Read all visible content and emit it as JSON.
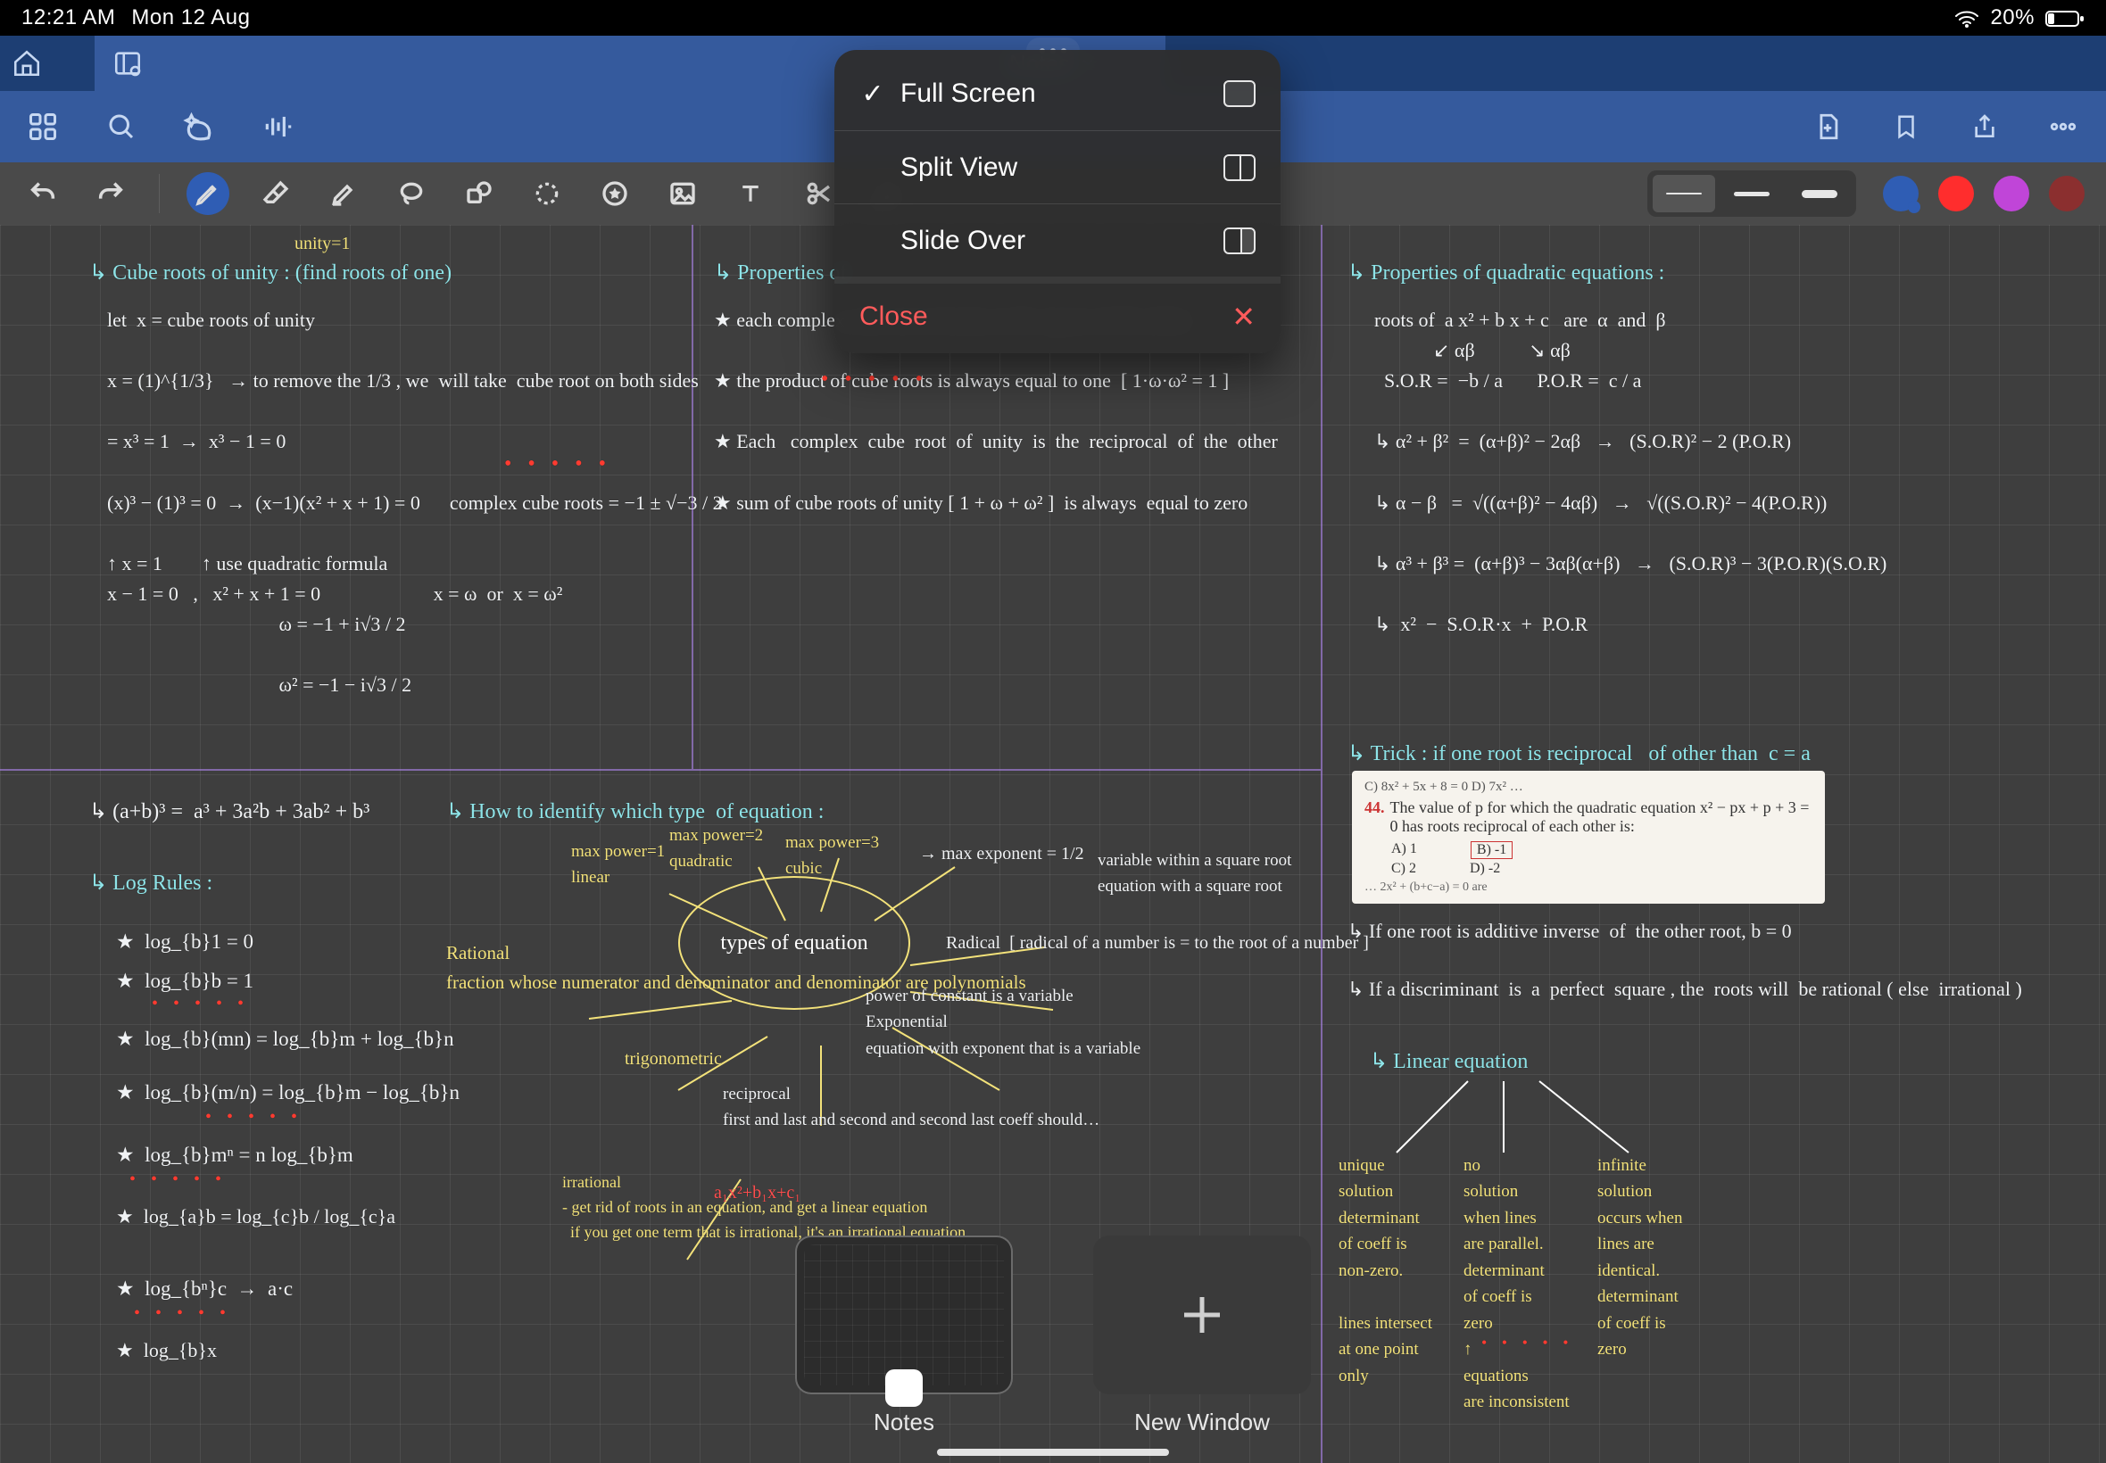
{
  "status": {
    "time": "12:21 AM",
    "date": "Mon 12 Aug",
    "battery_pct": "20%"
  },
  "app": {
    "tab_title": "Notes"
  },
  "toolbar_icons": {
    "grid": "grid-icon",
    "search": "search-icon",
    "ai": "sparkle-icon",
    "audio": "waveform-icon",
    "add_page": "new-page-icon",
    "bookmark": "bookmark-icon",
    "share": "share-icon",
    "more": "more-icon"
  },
  "tool_strip": {
    "tools": [
      "undo",
      "redo",
      "pen",
      "eraser",
      "highlighter",
      "lasso",
      "shape",
      "circular-select",
      "stamp",
      "image",
      "text",
      "scissors",
      "ruler"
    ],
    "weights": [
      "thin",
      "medium",
      "thick"
    ],
    "active_weight": "thin",
    "colors": [
      "#2f5db4",
      "#ff2d2d",
      "#c045d8",
      "#8b2f2f"
    ],
    "selected_color_index": 0
  },
  "popover": {
    "full_screen": "Full Screen",
    "split_view": "Split View",
    "slide_over": "Slide Over",
    "close": "Close",
    "selected": "Full Screen"
  },
  "switcher": {
    "notes_label": "Notes",
    "new_window_label": "New Window"
  },
  "notes": {
    "col1_heading": "↳ Cube roots of unity : (find roots of one)",
    "col1_body": "let  x = cube roots of unity\n\nx = (1)^{1/3}   → to remove the 1/3 , we  will take  cube root on both sides\n\n= x³ = 1  →  x³ − 1 = 0\n\n(x)³ − (1)³ = 0  →  (x−1)(x² + x + 1) = 0      complex cube roots = −1 ± √−3 / 2\n\n↑ x = 1        ↑ use quadratic formula\nx − 1 = 0   ,   x² + x + 1 = 0                       x = ω  or  x = ω²\n                                   ω = −1 + i√3 / 2\n\n                                   ω² = −1 − i√3 / 2",
    "col1b_heading": "↳ (a+b)³ =  a³ + 3a²b + 3ab² + b³",
    "log_heading": "↳ Log Rules :",
    "log_lines": [
      "★  log_{b}1 = 0",
      "★  log_{b}b = 1",
      "★  log_{b}(mn) = log_{b}m + log_{b}n",
      "★  log_{b}(m/n) = log_{b}m − log_{b}n",
      "★  log_{b}mⁿ = n log_{b}m",
      "★  log_{a}b = log_{c}b / log_{c}a",
      "★  log_{bⁿ}c  →  a·c"
    ],
    "log_extra": "★  log_{b}x",
    "col2_heading": "↳ Properties of",
    "col2_body": "★ each complex cube root of unity is the square of the other\n\n★ the product of cube roots is always equal to one  [ 1·ω·ω² = 1 ]\n\n★ Each   complex  cube  root  of  unity  is  the  reciprocal  of  the  other\n\n★ sum of cube roots of unity [ 1 + ω + ω² ]  is always  equal to zero",
    "mind_heading": "↳ How to identify which type  of equation :",
    "mind_center": "types of\nequation",
    "mind_branches": {
      "linear": "max power=1\nlinear",
      "quadratic": "max power=2\nquadratic",
      "cubic": "max power=3\ncubic",
      "half": "→ max exponent = 1/2",
      "sq": "variable within a square root\nequation with a square root",
      "radical": "Radical  [ radical of a number is = to the root of a number ]",
      "exp": "power of constant is a variable\nExponential\nequation with exponent that is a variable",
      "trig": "trigonometric",
      "rec": "reciprocal\nfirst and last and second and second last coeff should…",
      "rational": "Rational\nfraction whose numerator and denominator and denominator are polynomials",
      "irr": "irrational\n- get rid of roots in an equation, and get a linear equation\n  if you get one term that is irrational, it's an irrational equation"
    },
    "col3_heading": "↳ Properties of quadratic equations :",
    "col3_body": "roots of  a x² + b x + c   are  α  and  β\n            ↙ αβ           ↘ αβ\n  S.O.R =  −b / a       P.O.R =  c / a\n\n↳ α² + β²  =  (α+β)² − 2αβ   →   (S.O.R)² − 2 (P.O.R)\n\n↳ α − β   =  √((α+β)² − 4αβ)   →   √((S.O.R)² − 4(P.O.R))\n\n↳ α³ + β³ =  (α+β)³ − 3αβ(α+β)   →   (S.O.R)³ − 3(P.O.R)(S.O.R)\n\n↳  x²  −  S.O.R·x  +  P.O.R",
    "trick_heading": "↳ Trick : if one root is reciprocal   of other than  c = a",
    "qclip": {
      "prefix": "44.",
      "q": "The value of p for which the quadratic equation  x² − px + p + 3 = 0  has roots reciprocal of each other is:",
      "a": "A)  1",
      "b": "B)  -1",
      "c": "C)  2",
      "d": "D)  -2",
      "topline": "C) 8x² + 5x + 8 = 0                 D) 7x² …",
      "bottom": "… 2x² + (b+c−a) = 0  are"
    },
    "addinv": "↳ If one root is additive inverse  of  the other root, b = 0",
    "disc": "↳ If a discriminant  is  a  perfect  square , the  roots will  be rational ( else  irrational )",
    "linear_heading": "↳ Linear equation",
    "linear_cols": {
      "uniq": "unique\nsolution\ndeterminant\nof coeff is\nnon-zero.\n\nlines intersect\nat one point\nonly",
      "no": "no\nsolution\nwhen lines\nare parallel.\ndeterminant\nof coeff is\nzero\n↑\nequations\nare inconsistent",
      "inf": "infinite\nsolution\noccurs when\nlines are\nidentical.\ndeterminant\nof coeff is\nzero"
    },
    "unity_label": "unity=1",
    "red_dots": "• • • • •"
  }
}
